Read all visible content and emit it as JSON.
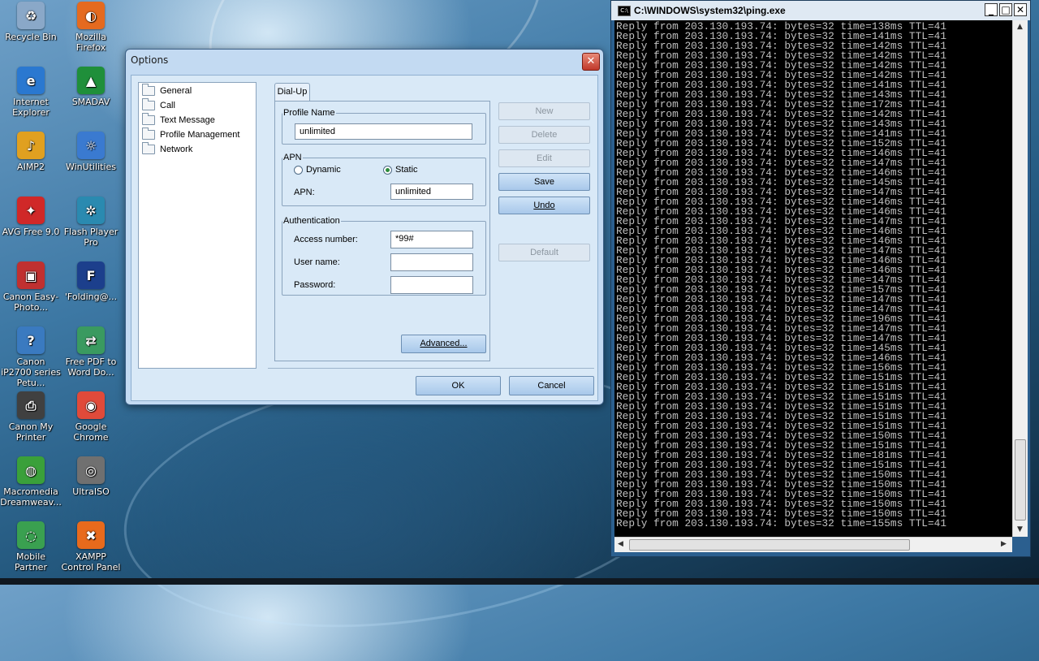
{
  "desktop": {
    "icons": [
      {
        "label": "Recycle Bin",
        "icon": "recycle-bin-icon"
      },
      {
        "label": "Mozilla Firefox",
        "icon": "firefox-icon"
      },
      {
        "label": "Internet Explorer",
        "icon": "internet-explorer-icon"
      },
      {
        "label": "SMADAV",
        "icon": "smadav-icon"
      },
      {
        "label": "AIMP2",
        "icon": "aimp-icon"
      },
      {
        "label": "WinUtilities",
        "icon": "winutilities-icon"
      },
      {
        "label": "AVG Free 9.0",
        "icon": "avg-icon"
      },
      {
        "label": "Flash Player Pro",
        "icon": "flash-player-icon"
      },
      {
        "label": "Canon Easy-Photo...",
        "icon": "canon-easyphoto-icon"
      },
      {
        "label": "'Folding@...",
        "icon": "folding-home-icon"
      },
      {
        "label": "Canon iP2700 series Petu...",
        "icon": "canon-ip2700-icon"
      },
      {
        "label": "Free PDF to Word Do...",
        "icon": "pdf-to-word-icon"
      },
      {
        "label": "Canon My Printer",
        "icon": "canon-my-printer-icon"
      },
      {
        "label": "Google Chrome",
        "icon": "chrome-icon"
      },
      {
        "label": "Macromedia Dreamweav...",
        "icon": "dreamweaver-icon"
      },
      {
        "label": "UltraISO",
        "icon": "ultraiso-icon"
      },
      {
        "label": "Mobile Partner",
        "icon": "mobile-partner-icon"
      },
      {
        "label": "XAMPP Control Panel",
        "icon": "xampp-icon"
      }
    ]
  },
  "options_dialog": {
    "title": "Options",
    "close": "✕",
    "tree": [
      "General",
      "Call",
      "Text Message",
      "Profile Management",
      "Network"
    ],
    "tab": "Dial-Up",
    "profile_name": {
      "legend": "Profile Name",
      "value": "unlimited"
    },
    "apn": {
      "legend": "APN",
      "dynamic": "Dynamic",
      "static": "Static",
      "selected": "Static",
      "label": "APN:",
      "value": "unlimited"
    },
    "auth": {
      "legend": "Authentication",
      "access_label": "Access number:",
      "access_value": "*99#",
      "user_label": "User name:",
      "user_value": "",
      "password_label": "Password:",
      "password_value": ""
    },
    "buttons": {
      "new": "New",
      "delete": "Delete",
      "edit": "Edit",
      "save": "Save",
      "undo": "Undo",
      "default": "Default",
      "advanced": "Advanced...",
      "ok": "OK",
      "cancel": "Cancel"
    }
  },
  "console": {
    "title": "C:\\WINDOWS\\system32\\ping.exe",
    "icon": "C:\\",
    "host": "203.130.193.74",
    "bytes": 32,
    "ttl": 41,
    "times_ms": [
      138,
      141,
      142,
      142,
      142,
      142,
      141,
      143,
      172,
      142,
      143,
      141,
      152,
      146,
      147,
      146,
      145,
      147,
      146,
      146,
      147,
      146,
      146,
      147,
      146,
      146,
      147,
      157,
      147,
      147,
      196,
      147,
      147,
      145,
      146,
      156,
      151,
      151,
      151,
      151,
      151,
      151,
      150,
      151,
      181,
      151,
      150,
      150,
      150,
      150,
      150,
      155
    ]
  },
  "colors": {
    "dialog_bg": "#c3daf2",
    "console_bg": "#000000",
    "console_text": "#c0c0c0",
    "close_red": "#c0392b"
  }
}
